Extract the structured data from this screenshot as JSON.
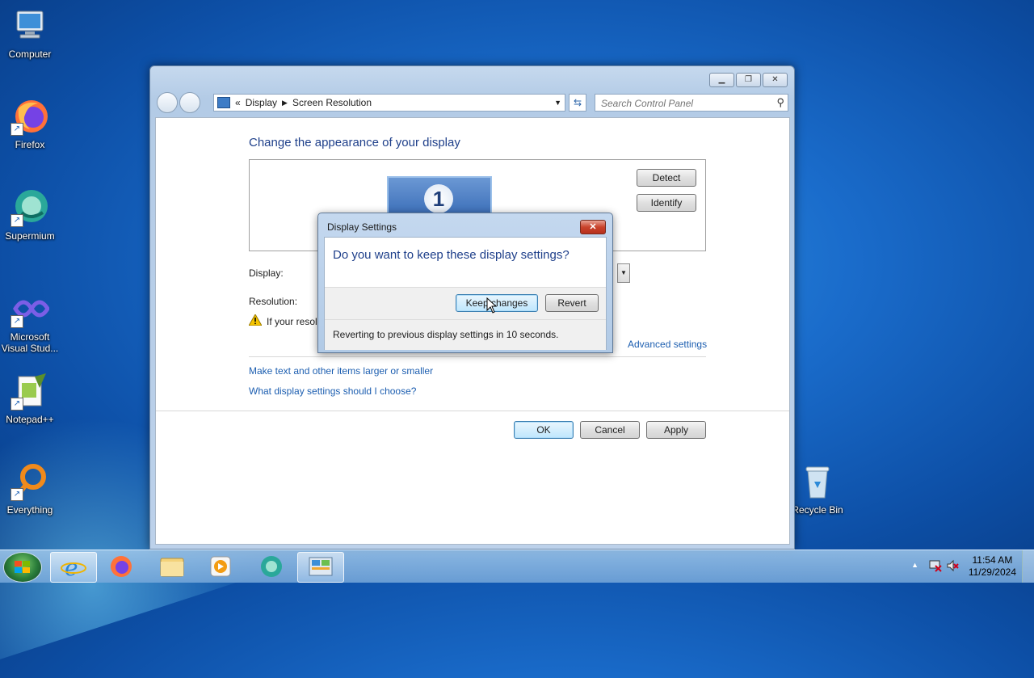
{
  "desktop": {
    "icons": [
      {
        "label": "Computer"
      },
      {
        "label": "Firefox"
      },
      {
        "label": "Supermium"
      },
      {
        "label": "Microsoft Visual Stud..."
      },
      {
        "label": "Notepad++"
      },
      {
        "label": "Everything"
      },
      {
        "label": "Recycle Bin"
      }
    ]
  },
  "window": {
    "breadcrumb": {
      "sep": "«",
      "items": [
        "Display",
        "Screen Resolution"
      ]
    },
    "search_placeholder": "Search Control Panel",
    "heading": "Change the appearance of your display",
    "monitor_number": "1",
    "detect_label": "Detect",
    "identify_label": "Identify",
    "display_label": "Display:",
    "resolution_label": "Resolution:",
    "warning_text": "If your resol",
    "advanced_link": "Advanced settings",
    "link_text_size": "Make text and other items larger or smaller",
    "link_choose": "What display settings should I choose?",
    "ok_label": "OK",
    "cancel_label": "Cancel",
    "apply_label": "Apply"
  },
  "dialog": {
    "title": "Display Settings",
    "question": "Do you want to keep these display settings?",
    "keep_label": "Keep changes",
    "revert_label": "Revert",
    "status": "Reverting to previous display settings in 10 seconds."
  },
  "taskbar": {
    "time": "11:54 AM",
    "date": "11/29/2024"
  },
  "colors": {
    "accent": "#1e3f8a",
    "link": "#1c5eb0"
  }
}
